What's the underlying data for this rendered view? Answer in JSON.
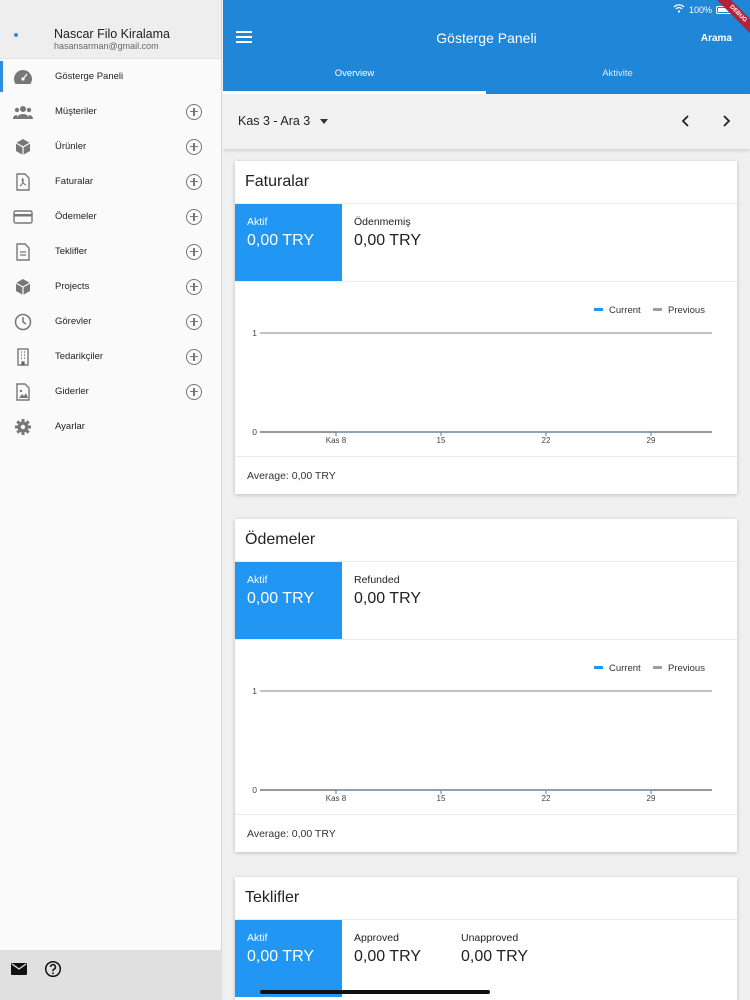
{
  "sidebar": {
    "company": "Nascar Filo Kiralama",
    "email": "hasansarman@gmail.com",
    "items": [
      {
        "label": "Gösterge Paneli",
        "icon": "dashboard-icon",
        "add": false
      },
      {
        "label": "Müşteriler",
        "icon": "users-icon",
        "add": true
      },
      {
        "label": "Ürünler",
        "icon": "cube-icon",
        "add": true
      },
      {
        "label": "Faturalar",
        "icon": "pdf-file-icon",
        "add": true
      },
      {
        "label": "Ödemeler",
        "icon": "credit-card-icon",
        "add": true
      },
      {
        "label": "Teklifler",
        "icon": "document-icon",
        "add": true
      },
      {
        "label": "Projects",
        "icon": "cube-icon",
        "add": true
      },
      {
        "label": "Görevler",
        "icon": "clock-icon",
        "add": true
      },
      {
        "label": "Tedarikçiler",
        "icon": "building-icon",
        "add": true
      },
      {
        "label": "Giderler",
        "icon": "image-file-icon",
        "add": true
      },
      {
        "label": "Ayarlar",
        "icon": "gear-icon",
        "add": false
      }
    ]
  },
  "status": {
    "battery": "100%"
  },
  "debug_label": "DEBUG",
  "header": {
    "title": "Gösterge Paneli",
    "search": "Arama"
  },
  "tabs": [
    {
      "label": "Overview"
    },
    {
      "label": "Aktivite"
    }
  ],
  "date_range": "Kas 3 - Ara 3",
  "cards": [
    {
      "title": "Faturalar",
      "stats": [
        {
          "label": "Aktif",
          "value": "0,00 TRY"
        },
        {
          "label": "Ödenmemiş",
          "value": "0,00 TRY"
        }
      ],
      "average": "Average: 0,00 TRY"
    },
    {
      "title": "Ödemeler",
      "stats": [
        {
          "label": "Aktif",
          "value": "0,00 TRY"
        },
        {
          "label": "Refunded",
          "value": "0,00 TRY"
        }
      ],
      "average": "Average: 0,00 TRY"
    },
    {
      "title": "Teklifler",
      "stats": [
        {
          "label": "Aktif",
          "value": "0,00 TRY"
        },
        {
          "label": "Approved",
          "value": "0,00 TRY"
        },
        {
          "label": "Unapproved",
          "value": "0,00 TRY"
        }
      ]
    }
  ],
  "chart_data": [
    {
      "type": "line",
      "x": [
        "Kas 8",
        "15",
        "22",
        "29"
      ],
      "series": [
        {
          "name": "Current",
          "values": [
            0,
            0,
            0,
            0
          ]
        },
        {
          "name": "Previous",
          "values": [
            0,
            0,
            0,
            0
          ]
        }
      ],
      "yticks": [
        "1",
        "0"
      ],
      "ylim": [
        0,
        1
      ],
      "legend": "top-right",
      "colors": {
        "Current": "#2196f3",
        "Previous": "#9e9e9e"
      }
    },
    {
      "type": "line",
      "x": [
        "Kas 8",
        "15",
        "22",
        "29"
      ],
      "series": [
        {
          "name": "Current",
          "values": [
            0,
            0,
            0,
            0
          ]
        },
        {
          "name": "Previous",
          "values": [
            0,
            0,
            0,
            0
          ]
        }
      ],
      "yticks": [
        "1",
        "0"
      ],
      "ylim": [
        0,
        1
      ],
      "legend": "top-right",
      "colors": {
        "Current": "#2196f3",
        "Previous": "#9e9e9e"
      }
    }
  ]
}
